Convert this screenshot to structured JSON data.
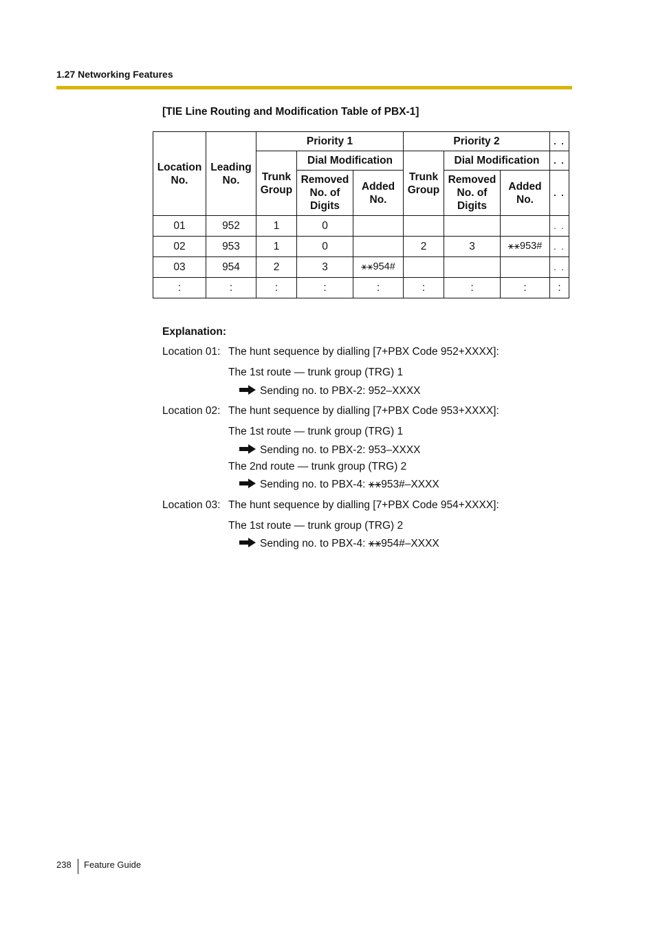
{
  "header": {
    "section": "1.27 Networking Features",
    "accent_color": "#dbb400"
  },
  "table": {
    "title": "[TIE Line Routing and Modification Table of PBX-1]",
    "headers": {
      "location": [
        "Location",
        "No."
      ],
      "leading": [
        "Leading",
        "No."
      ],
      "priority1": "Priority 1",
      "priority2": "Priority 2",
      "dial_modification": "Dial Modification",
      "trunk_group": [
        "Trunk",
        "Group"
      ],
      "removed": [
        "Removed",
        "No. of",
        "Digits"
      ],
      "added": [
        "Added",
        "No."
      ],
      "more": ". ."
    },
    "rows": [
      {
        "location": "01",
        "leading": "952",
        "p1_trunk": "1",
        "p1_removed": "0",
        "p1_added": "",
        "p2_trunk": "",
        "p2_removed": "",
        "p2_added": "",
        "more": ". ."
      },
      {
        "location": "02",
        "leading": "953",
        "p1_trunk": "1",
        "p1_removed": "0",
        "p1_added": "",
        "p2_trunk": "2",
        "p2_removed": "3",
        "p2_added": "⚹⚹953#",
        "more": ". ."
      },
      {
        "location": "03",
        "leading": "954",
        "p1_trunk": "2",
        "p1_removed": "3",
        "p1_added": "⚹⚹954#",
        "p2_trunk": "",
        "p2_removed": "",
        "p2_added": "",
        "more": ". ."
      },
      {
        "location": ":",
        "leading": ":",
        "p1_trunk": ":",
        "p1_removed": ":",
        "p1_added": ":",
        "p2_trunk": ":",
        "p2_removed": ":",
        "p2_added": ":",
        "more": ":"
      }
    ]
  },
  "explanation": {
    "title": "Explanation:",
    "locations": [
      {
        "label": "Location 01:",
        "text": "The hunt sequence by dialling [7+PBX Code 952+XXXX]:",
        "routes": [
          {
            "route": "The 1st route — trunk group (TRG) 1",
            "sending": "Sending no. to PBX-2: 952–XXXX"
          }
        ]
      },
      {
        "label": "Location 02:",
        "text": "The hunt sequence by dialling [7+PBX Code 953+XXXX]:",
        "routes": [
          {
            "route": "The 1st route — trunk group (TRG) 1",
            "sending": "Sending no. to PBX-2: 953–XXXX"
          },
          {
            "route": "The 2nd route — trunk group (TRG) 2",
            "sending": "Sending no. to PBX-4: ⚹⚹953#–XXXX"
          }
        ]
      },
      {
        "label": "Location 03:",
        "text": "The hunt sequence by dialling [7+PBX Code 954+XXXX]:",
        "routes": [
          {
            "route": "The 1st route — trunk group (TRG) 2",
            "sending": "Sending no. to PBX-4: ⚹⚹954#–XXXX"
          }
        ]
      }
    ]
  },
  "footer": {
    "page_number": "238",
    "title": "Feature Guide"
  }
}
